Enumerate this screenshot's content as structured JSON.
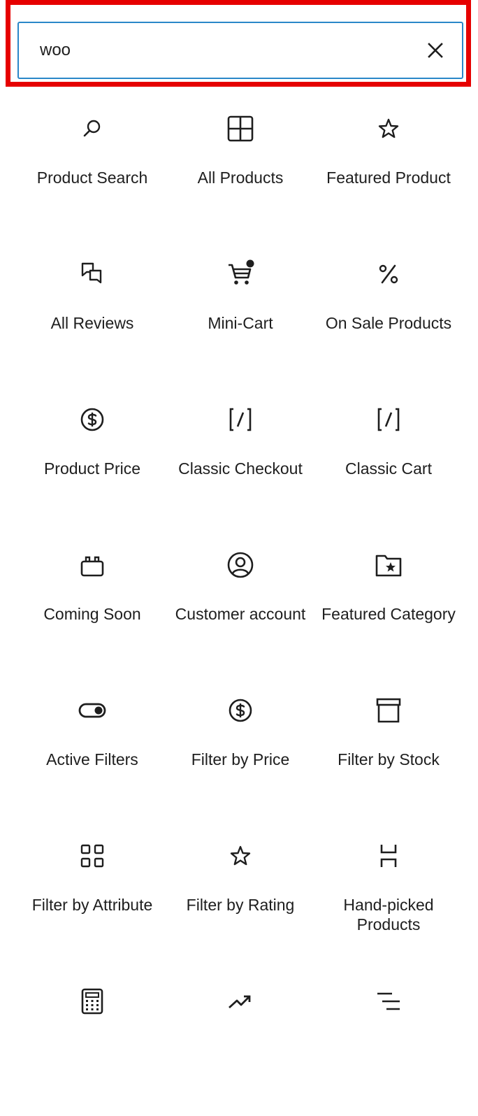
{
  "search": {
    "value": "woo",
    "clear_icon": "close-icon"
  },
  "blocks": [
    {
      "label": "Product Search",
      "icon": "search-icon"
    },
    {
      "label": "All Products",
      "icon": "grid-icon"
    },
    {
      "label": "Featured Product",
      "icon": "star-icon"
    },
    {
      "label": "All Reviews",
      "icon": "comments-icon"
    },
    {
      "label": "Mini-Cart",
      "icon": "cart-icon"
    },
    {
      "label": "On Sale Products",
      "icon": "percent-icon"
    },
    {
      "label": "Product Price",
      "icon": "dollar-circle-icon"
    },
    {
      "label": "Classic Checkout",
      "icon": "shortcode-icon"
    },
    {
      "label": "Classic Cart",
      "icon": "shortcode-icon"
    },
    {
      "label": "Coming Soon",
      "icon": "cake-icon"
    },
    {
      "label": "Customer account",
      "icon": "user-circle-icon"
    },
    {
      "label": "Featured Category",
      "icon": "folder-star-icon"
    },
    {
      "label": "Active Filters",
      "icon": "toggle-icon"
    },
    {
      "label": "Filter by Price",
      "icon": "dollar-circle-icon"
    },
    {
      "label": "Filter by Stock",
      "icon": "archive-icon"
    },
    {
      "label": "Filter by Attribute",
      "icon": "category-icon"
    },
    {
      "label": "Filter by Rating",
      "icon": "star-icon"
    },
    {
      "label": "Hand-picked Products",
      "icon": "handpicked-icon"
    },
    {
      "label": "",
      "icon": "calculator-icon"
    },
    {
      "label": "",
      "icon": "trending-up-icon"
    },
    {
      "label": "",
      "icon": "text-lines-icon"
    }
  ],
  "colors": {
    "highlight": "#e60000",
    "input_border": "#2a87c8",
    "text": "#1e1e1e"
  }
}
